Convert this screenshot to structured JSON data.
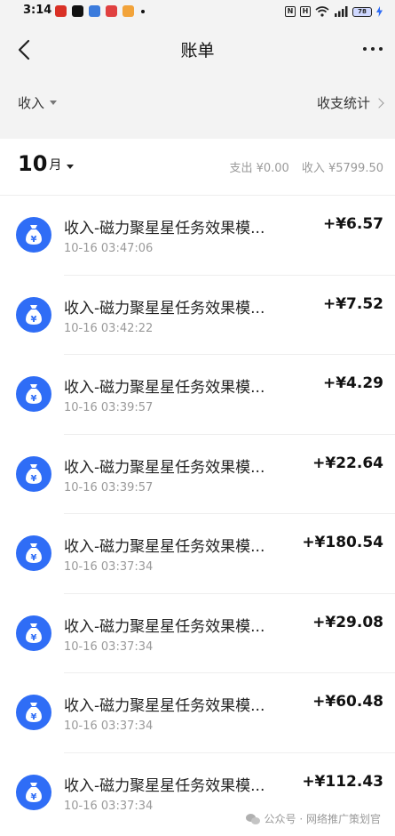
{
  "status_bar": {
    "time": "3:14",
    "battery": "78",
    "notif_colors": [
      "#d93025",
      "#111111",
      "#3b7bdc",
      "#e04040",
      "#f2a33a"
    ]
  },
  "header": {
    "title": "账单"
  },
  "filter": {
    "type_label": "收入",
    "stats_label": "收支统计"
  },
  "month": {
    "number": "10",
    "unit": "月",
    "expense": "支出 ¥0.00",
    "income": "收入 ¥5799.50"
  },
  "colors": {
    "accent": "#2f6df6"
  },
  "transactions": [
    {
      "title": "收入-磁力聚星星任务效果模...",
      "time": "10-16 03:47:06",
      "amount": "+¥6.57"
    },
    {
      "title": "收入-磁力聚星星任务效果模...",
      "time": "10-16 03:42:22",
      "amount": "+¥7.52"
    },
    {
      "title": "收入-磁力聚星星任务效果模...",
      "time": "10-16 03:39:57",
      "amount": "+¥4.29"
    },
    {
      "title": "收入-磁力聚星星任务效果模...",
      "time": "10-16 03:39:57",
      "amount": "+¥22.64"
    },
    {
      "title": "收入-磁力聚星星任务效果模...",
      "time": "10-16 03:37:34",
      "amount": "+¥180.54"
    },
    {
      "title": "收入-磁力聚星星任务效果模...",
      "time": "10-16 03:37:34",
      "amount": "+¥29.08"
    },
    {
      "title": "收入-磁力聚星星任务效果模...",
      "time": "10-16 03:37:34",
      "amount": "+¥60.48"
    },
    {
      "title": "收入-磁力聚星星任务效果模...",
      "time": "10-16 03:37:34",
      "amount": "+¥112.43"
    }
  ],
  "watermark": {
    "text": "公众号 · 网络推广策划官"
  }
}
